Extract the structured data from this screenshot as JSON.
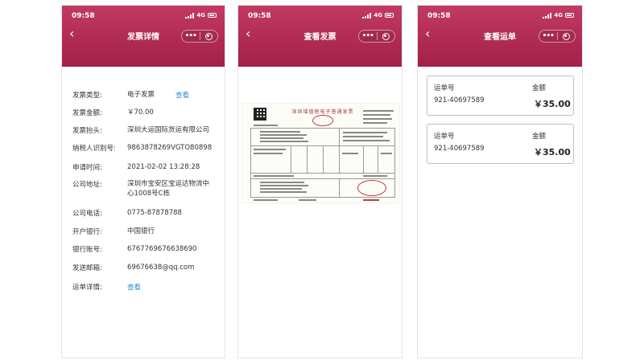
{
  "status_bar": {
    "time": "09:58",
    "network": "4G"
  },
  "screens": [
    {
      "title": "发票详情",
      "rows": [
        {
          "label": "发票类型:",
          "value": "电子发票",
          "link": "查看"
        },
        {
          "label": "发票金额:",
          "value": "￥70.00"
        },
        {
          "label": "发票抬头:",
          "value": "深圳大运国际货运有限公司"
        },
        {
          "label": "纳税人识别号:",
          "value": "9863878269VGTO80898"
        },
        {
          "label": "申请时间:",
          "value": "2021-02-02 13:28:28"
        },
        {
          "label": "公司地址:",
          "value_line1": "深圳市宝安区宝运达物流中",
          "value_line2": "心1008号C栋"
        },
        {
          "label": "公司电话:",
          "value": "0775-87878788"
        },
        {
          "label": "开户银行:",
          "value": "中国银行"
        },
        {
          "label": "银行账号:",
          "value": "6767769676638690"
        },
        {
          "label": "发送邮箱:",
          "value": "69676638@qq.com"
        },
        {
          "label": "运单详情:",
          "link": "查看"
        }
      ]
    },
    {
      "title": "查看发票",
      "invoice_title": "深圳增值税电子普通发票"
    },
    {
      "title": "查看运单",
      "cards": [
        {
          "waybill_label": "运单号",
          "waybill_no": "921-40697589",
          "amount_label": "金额",
          "amount": "￥35.00"
        },
        {
          "waybill_label": "运单号",
          "waybill_no": "921-40697589",
          "amount_label": "金额",
          "amount": "￥35.00"
        }
      ]
    }
  ],
  "colors": {
    "header": "#b02a54",
    "link": "#2a8ed8"
  },
  "icons": [
    "back-arrow-icon",
    "more-dots-icon",
    "target-circle-icon",
    "signal-icon",
    "battery-icon"
  ]
}
